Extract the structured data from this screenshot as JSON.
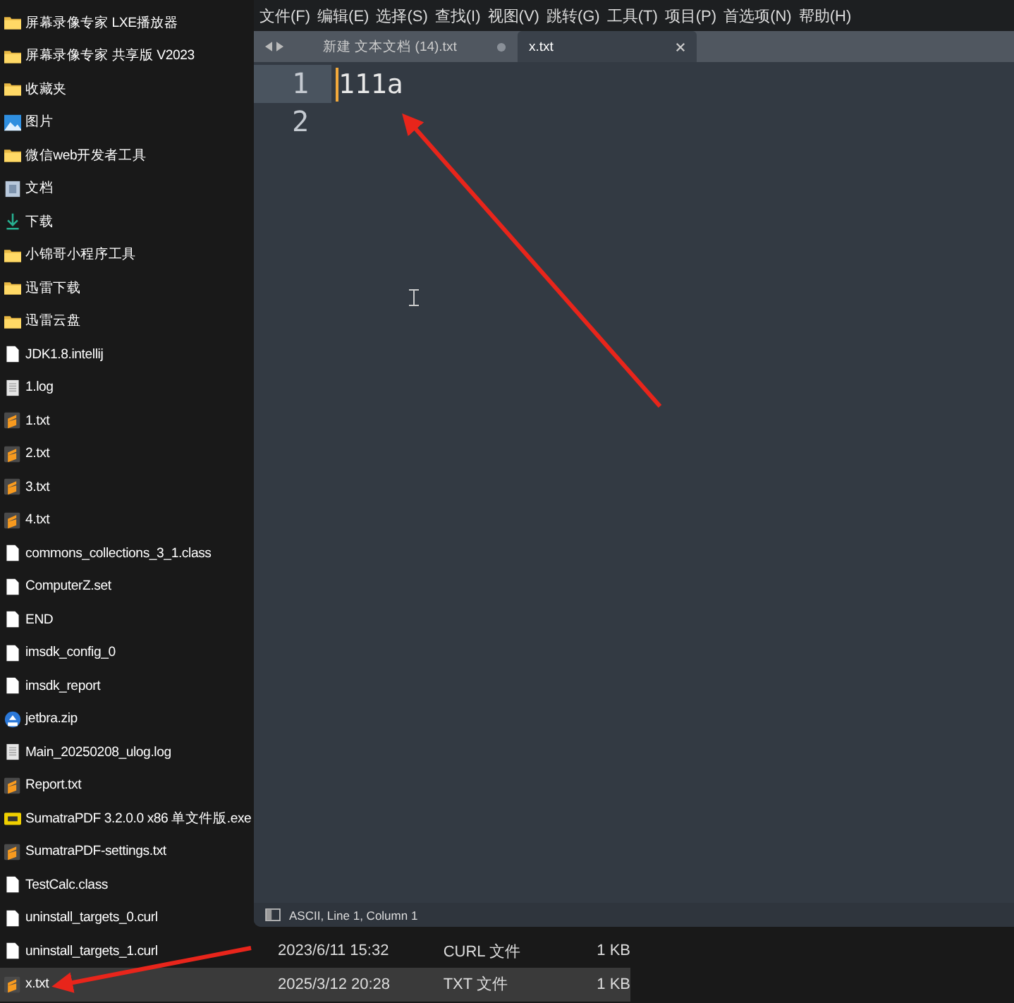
{
  "files": [
    {
      "name": "屏幕录像专家 LXE播放器",
      "kind": "folder",
      "selected": false
    },
    {
      "name": "屏幕录像专家 共享版 V2023",
      "kind": "folder",
      "selected": false
    },
    {
      "name": "收藏夹",
      "kind": "folder",
      "selected": false
    },
    {
      "name": "图片",
      "kind": "pictures",
      "selected": false
    },
    {
      "name": "微信web开发者工具",
      "kind": "folder",
      "selected": false
    },
    {
      "name": "文档",
      "kind": "documents",
      "selected": false
    },
    {
      "name": "下载",
      "kind": "download",
      "selected": false
    },
    {
      "name": "小锦哥小程序工具",
      "kind": "folder",
      "selected": false
    },
    {
      "name": "迅雷下载",
      "kind": "folder",
      "selected": false
    },
    {
      "name": "迅雷云盘",
      "kind": "folder",
      "selected": false
    },
    {
      "name": "JDK1.8.intellij",
      "kind": "file",
      "selected": false
    },
    {
      "name": "1.log",
      "kind": "log",
      "selected": false
    },
    {
      "name": "1.txt",
      "kind": "sublime",
      "selected": false
    },
    {
      "name": "2.txt",
      "kind": "sublime",
      "selected": false
    },
    {
      "name": "3.txt",
      "kind": "sublime",
      "selected": false
    },
    {
      "name": "4.txt",
      "kind": "sublime",
      "selected": false
    },
    {
      "name": "commons_collections_3_1.class",
      "kind": "file",
      "selected": false
    },
    {
      "name": "ComputerZ.set",
      "kind": "file",
      "selected": false
    },
    {
      "name": "END",
      "kind": "file",
      "selected": false
    },
    {
      "name": "imsdk_config_0",
      "kind": "file",
      "selected": false
    },
    {
      "name": "imsdk_report",
      "kind": "file",
      "selected": false
    },
    {
      "name": "jetbra.zip",
      "kind": "zip",
      "selected": false
    },
    {
      "name": "Main_20250208_ulog.log",
      "kind": "log",
      "selected": false
    },
    {
      "name": "Report.txt",
      "kind": "sublime",
      "selected": false
    },
    {
      "name": "SumatraPDF 3.2.0.0 x86 单文件版.exe",
      "kind": "exe",
      "selected": false
    },
    {
      "name": "SumatraPDF-settings.txt",
      "kind": "sublime",
      "selected": false
    },
    {
      "name": "TestCalc.class",
      "kind": "file",
      "selected": false
    },
    {
      "name": "uninstall_targets_0.curl",
      "kind": "file",
      "selected": false
    },
    {
      "name": "uninstall_targets_1.curl",
      "kind": "file",
      "selected": false,
      "date": "2023/6/11 15:32",
      "type": "CURL 文件",
      "size": "1 KB"
    },
    {
      "name": "x.txt",
      "kind": "sublime",
      "selected": true,
      "date": "2025/3/12 20:28",
      "type": "TXT 文件",
      "size": "1 KB"
    }
  ],
  "editor": {
    "menu": [
      "文件(F)",
      "编辑(E)",
      "选择(S)",
      "查找(I)",
      "视图(V)",
      "跳转(G)",
      "工具(T)",
      "项目(P)",
      "首选项(N)",
      "帮助(H)"
    ],
    "tabs": [
      {
        "label": "新建 文本文档 (14).txt",
        "selected": false,
        "modified": true
      },
      {
        "label": "x.txt",
        "selected": true,
        "modified": false
      }
    ],
    "lines": [
      {
        "number": "1",
        "text": "111a",
        "current": true
      },
      {
        "number": "2",
        "current": false
      }
    ],
    "status": "ASCII, Line 1, Column 1"
  }
}
